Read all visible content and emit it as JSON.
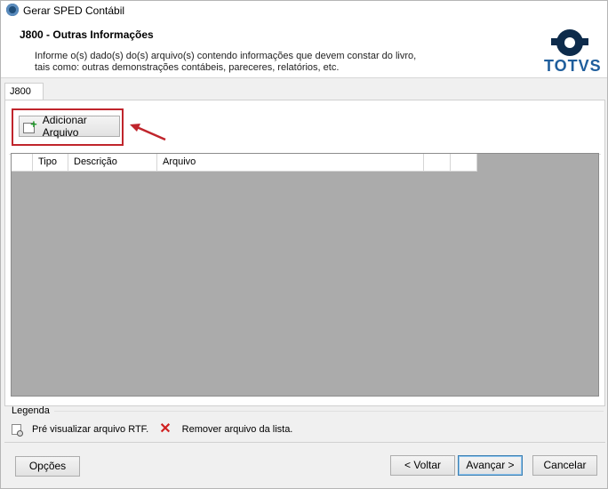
{
  "window": {
    "title": "Gerar SPED Contábil"
  },
  "header": {
    "title": "J800 - Outras Informações",
    "description": "Informe o(s) dado(s) do(s) arquivo(s) contendo informações que devem constar do livro,\ntais como: outras demonstrações contábeis, pareceres, relatórios, etc.",
    "logo_text": "TOTVS"
  },
  "tabs": [
    {
      "label": "J800"
    }
  ],
  "toolbar": {
    "add_file_label": "Adicionar Arquivo"
  },
  "grid": {
    "columns": [
      "",
      "Tipo",
      "Descrição",
      "Arquivo",
      "",
      ""
    ]
  },
  "legend": {
    "label": "Legenda",
    "preview_text": "Pré visualizar arquivo RTF.",
    "remove_text": "Remover arquivo da lista."
  },
  "footer": {
    "options_label": "Opções",
    "back_label": "< Voltar",
    "next_label": "Avançar >",
    "cancel_label": "Cancelar"
  },
  "colors": {
    "highlight": "#c0252c",
    "grid_bg": "#ababab",
    "logo": "#1f5e9c"
  }
}
